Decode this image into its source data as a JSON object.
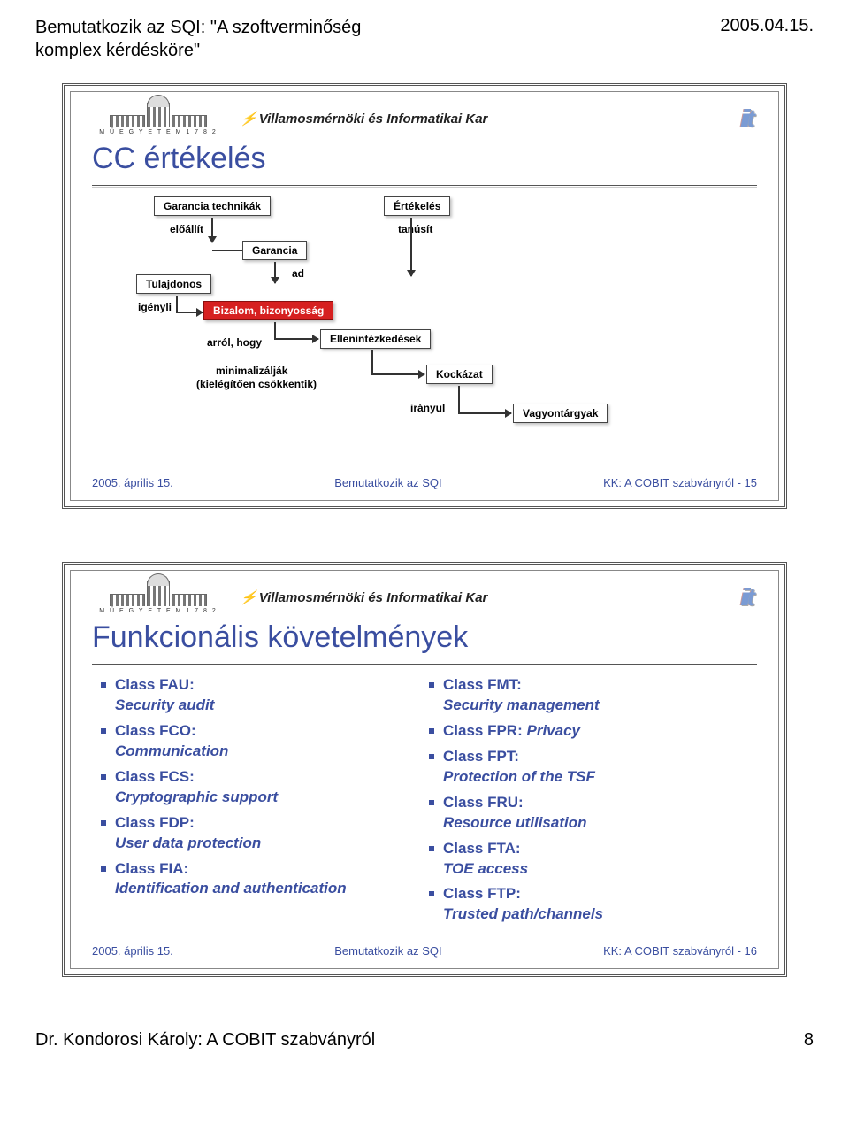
{
  "page_header": {
    "title_line1": "Bemutatkozik az SQI: \"A szoftverminőség",
    "title_line2": "komplex kérdésköre\"",
    "date": "2005.04.15."
  },
  "logos": {
    "univ_caption": "M Ű E G Y E T E M   1 7 8 2",
    "dept": "Villamosmérnöki és Informatikai Kar",
    "iit": "iit"
  },
  "slide1": {
    "title": "CC értékelés",
    "boxes": {
      "garancia_tech": "Garancia technikák",
      "ertekeles": "Értékelés",
      "garancia": "Garancia",
      "tulajdonos": "Tulajdonos",
      "bizalom": "Bizalom, bizonyosság",
      "ellen": "Ellenintézkedések",
      "kockazat": "Kockázat",
      "vagyon": "Vagyontárgyak"
    },
    "labels": {
      "eloallit": "előállít",
      "tanusit": "tanúsít",
      "ad": "ad",
      "igenyli": "igényli",
      "arrol_hogy": "arról, hogy",
      "minimal1": "minimalizálják",
      "minimal2": "(kielégítően csökkentik)",
      "iranyul": "irányul"
    },
    "footer": {
      "left": "2005. április 15.",
      "mid": "Bemutatkozik az SQI",
      "right": "KK: A COBIT szabványról - 15"
    }
  },
  "slide2": {
    "title": "Funkcionális követelmények",
    "left_items": [
      {
        "head": "Class FAU:",
        "sub": "Security audit"
      },
      {
        "head": "Class FCO:",
        "sub": "Communication"
      },
      {
        "head": "Class FCS:",
        "sub": "Cryptographic support"
      },
      {
        "head": "Class FDP:",
        "sub": "User data protection"
      },
      {
        "head": "Class FIA:",
        "sub": "Identification and authentication"
      }
    ],
    "right_items": [
      {
        "head": "Class FMT:",
        "sub": "Security management"
      },
      {
        "head": "Class FPR:",
        "sub_inline": "Privacy"
      },
      {
        "head": "Class FPT:",
        "sub": "Protection of the TSF"
      },
      {
        "head": "Class FRU:",
        "sub": "Resource utilisation"
      },
      {
        "head": "Class FTA:",
        "sub": "TOE access"
      },
      {
        "head": "Class FTP:",
        "sub": "Trusted path/channels"
      }
    ],
    "footer": {
      "left": "2005. április 15.",
      "mid": "Bemutatkozik az SQI",
      "right": "KK: A COBIT szabványról - 16"
    }
  },
  "page_footer": {
    "left": "Dr. Kondorosi Károly: A COBIT szabványról",
    "right": "8"
  }
}
